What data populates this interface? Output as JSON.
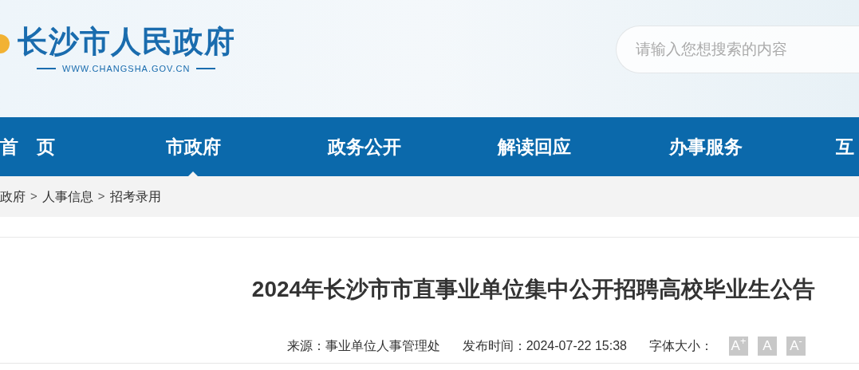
{
  "header": {
    "logo_title": "长沙市人民政府",
    "logo_url": "WWW.CHANGSHA.GOV.CN",
    "search": {
      "placeholder": "请输入您想搜索的内容"
    }
  },
  "nav": [
    {
      "label": "首　页",
      "selected": false
    },
    {
      "label": "市政府",
      "selected": true
    },
    {
      "label": "政务公开",
      "selected": false
    },
    {
      "label": "解读回应",
      "selected": false
    },
    {
      "label": "办事服务",
      "selected": false
    },
    {
      "label": "互",
      "selected": false
    }
  ],
  "breadcrumb": [
    {
      "kind": "link",
      "text": "政府"
    },
    {
      "kind": "separator",
      "text": ">"
    },
    {
      "kind": "link",
      "text": "人事信息"
    },
    {
      "kind": "separator",
      "text": ">"
    },
    {
      "kind": "link",
      "text": "招考录用"
    }
  ],
  "article": {
    "title": "2024年长沙市市直事业单位集中公开招聘高校毕业生公告",
    "source": "来源：事业单位人事管理处",
    "published": "发布时间：2024-07-22 15:38",
    "font_size_label": "字体大小：",
    "font_size_buttons": [
      "A$^{+}$",
      "A",
      "A$^{-}$"
    ]
  }
}
